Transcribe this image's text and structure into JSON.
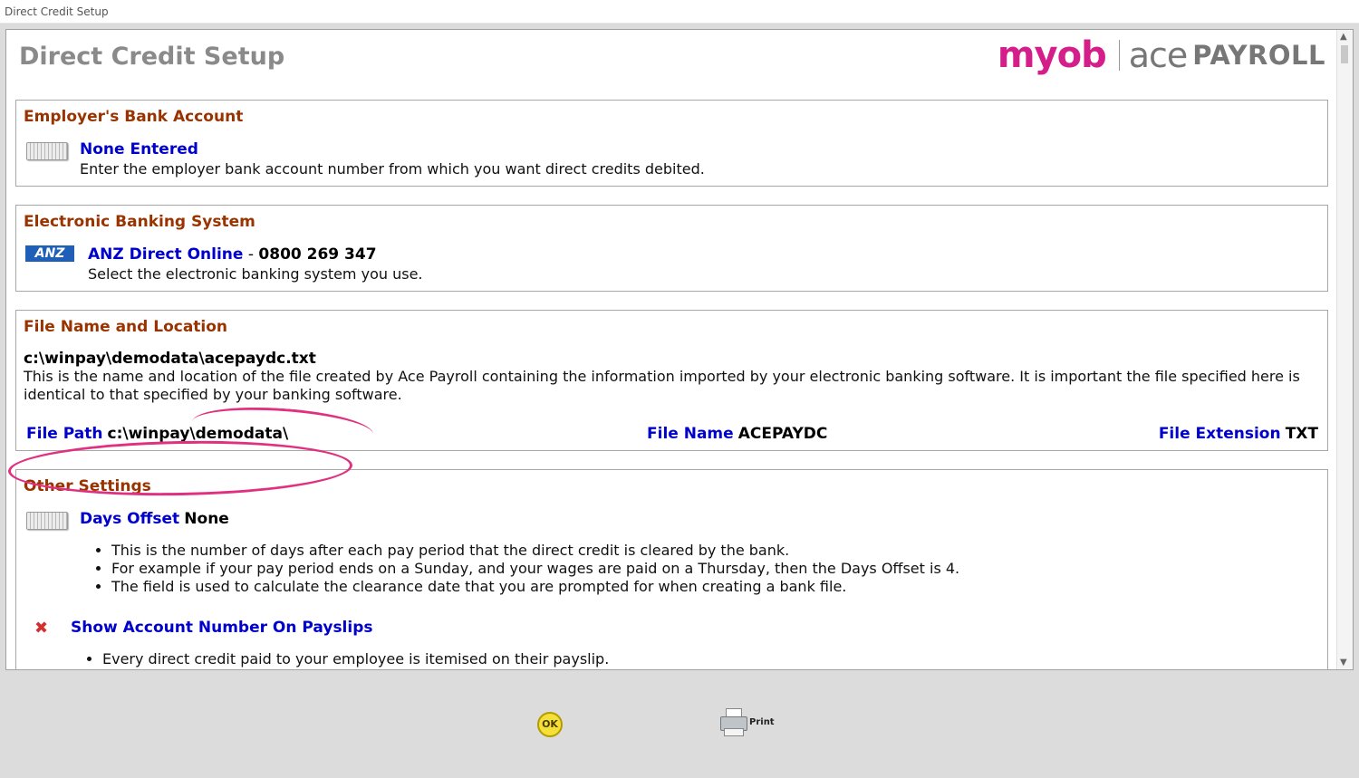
{
  "window": {
    "title": "Direct Credit Setup"
  },
  "page": {
    "title": "Direct Credit Setup"
  },
  "logo": {
    "myob": "myob",
    "ace": "ace",
    "payroll": "PAYROLL"
  },
  "employer_bank": {
    "heading": "Employer's Bank Account",
    "link": "None Entered",
    "description": "Enter the employer bank account number from which you want direct credits debited."
  },
  "banking_system": {
    "heading": "Electronic Banking System",
    "icon_text": "ANZ",
    "link": "ANZ Direct Online",
    "separator": " - ",
    "phone": "0800 269 347",
    "description": "Select the electronic banking system you use."
  },
  "file_location": {
    "heading": "File Name and Location",
    "full_path": "c:\\winpay\\demodata\\acepaydc.txt",
    "description": "This is the name and location of the file created by Ace Payroll containing the information imported by your electronic banking software. It is important the file specified here is identical to that specified by your banking software.",
    "file_path_label": "File Path",
    "file_path_value": "c:\\winpay\\demodata\\",
    "file_name_label": "File Name",
    "file_name_value": "ACEPAYDC",
    "file_ext_label": "File Extension",
    "file_ext_value": "TXT"
  },
  "other_settings": {
    "heading": "Other Settings",
    "days_offset_label": "Days Offset",
    "days_offset_value": "None",
    "days_offset_bullets": [
      "This is the number of days after each pay period that the direct credit is cleared by the bank.",
      "For example if your pay period ends on a Sunday, and your wages are paid on a Thursday, then the Days Offset is 4.",
      "The field is used to calculate the clearance date that you are prompted for when creating a bank file."
    ],
    "show_account_label": "Show Account Number On Payslips",
    "show_account_bullets": [
      "Every direct credit paid to your employee is itemised on their payslip."
    ]
  },
  "footer": {
    "ok_label": "OK",
    "print_label": "Print"
  }
}
